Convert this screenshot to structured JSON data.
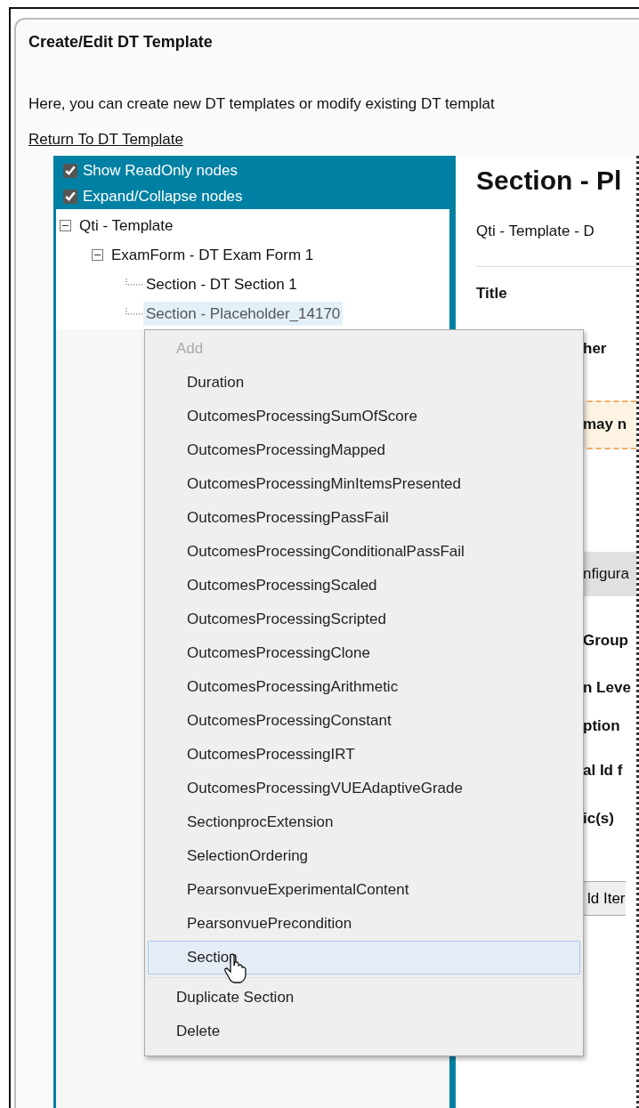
{
  "panel": {
    "title": "Create/Edit DT Template",
    "description": "Here, you can create new DT templates or modify existing DT templat",
    "return_link": "Return To DT Template"
  },
  "tree_options": [
    {
      "label": "Show ReadOnly nodes",
      "checked": true
    },
    {
      "label": "Expand/Collapse nodes",
      "checked": true
    }
  ],
  "tree": [
    {
      "label": "Qti - Template",
      "expanded": true,
      "selected": false,
      "children": [
        {
          "label": "ExamForm - DT Exam Form 1",
          "expanded": true,
          "selected": false,
          "children": [
            {
              "label": "Section - DT Section 1",
              "selected": false
            },
            {
              "label": "Section - Placeholder_14170",
              "selected": true
            }
          ]
        }
      ]
    }
  ],
  "detail": {
    "heading": "Section - Pl",
    "breadcrumb": "Qti - Template - D",
    "rows": [
      {
        "kind": "label",
        "text": "Title"
      },
      {
        "kind": "label",
        "text": "her"
      },
      {
        "kind": "warning",
        "text": "may n"
      },
      {
        "kind": "bar",
        "text": "nfigura"
      },
      {
        "kind": "label",
        "text": "Group"
      },
      {
        "kind": "label",
        "text": "n Leve"
      },
      {
        "kind": "label",
        "text": "ption"
      },
      {
        "kind": "label",
        "text": "al Id f"
      },
      {
        "kind": "label",
        "text": "ic(s)"
      },
      {
        "kind": "button",
        "text": "ld Iter"
      }
    ]
  },
  "context_menu": {
    "items": [
      {
        "kind": "header",
        "label": "Add",
        "disabled": true,
        "selected": false
      },
      {
        "kind": "sub",
        "label": "Duration",
        "disabled": false,
        "selected": false
      },
      {
        "kind": "sub",
        "label": "OutcomesProcessingSumOfScore",
        "disabled": false,
        "selected": false
      },
      {
        "kind": "sub",
        "label": "OutcomesProcessingMapped",
        "disabled": false,
        "selected": false
      },
      {
        "kind": "sub",
        "label": "OutcomesProcessingMinItemsPresented",
        "disabled": false,
        "selected": false
      },
      {
        "kind": "sub",
        "label": "OutcomesProcessingPassFail",
        "disabled": false,
        "selected": false
      },
      {
        "kind": "sub",
        "label": "OutcomesProcessingConditionalPassFail",
        "disabled": false,
        "selected": false
      },
      {
        "kind": "sub",
        "label": "OutcomesProcessingScaled",
        "disabled": false,
        "selected": false
      },
      {
        "kind": "sub",
        "label": "OutcomesProcessingScripted",
        "disabled": false,
        "selected": false
      },
      {
        "kind": "sub",
        "label": "OutcomesProcessingClone",
        "disabled": false,
        "selected": false
      },
      {
        "kind": "sub",
        "label": "OutcomesProcessingArithmetic",
        "disabled": false,
        "selected": false
      },
      {
        "kind": "sub",
        "label": "OutcomesProcessingConstant",
        "disabled": false,
        "selected": false
      },
      {
        "kind": "sub",
        "label": "OutcomesProcessingIRT",
        "disabled": false,
        "selected": false
      },
      {
        "kind": "sub",
        "label": "OutcomesProcessingVUEAdaptiveGrade",
        "disabled": false,
        "selected": false
      },
      {
        "kind": "sub",
        "label": "SectionprocExtension",
        "disabled": false,
        "selected": false
      },
      {
        "kind": "sub",
        "label": "SelectionOrdering",
        "disabled": false,
        "selected": false
      },
      {
        "kind": "sub",
        "label": "PearsonvueExperimentalContent",
        "disabled": false,
        "selected": false
      },
      {
        "kind": "sub",
        "label": "PearsonvuePrecondition",
        "disabled": false,
        "selected": false
      },
      {
        "kind": "sub",
        "label": "Section",
        "disabled": false,
        "selected": true
      },
      {
        "kind": "separator"
      },
      {
        "kind": "top",
        "label": "Duplicate Section",
        "disabled": false,
        "selected": false
      },
      {
        "kind": "top",
        "label": "Delete",
        "disabled": false,
        "selected": false
      }
    ]
  }
}
